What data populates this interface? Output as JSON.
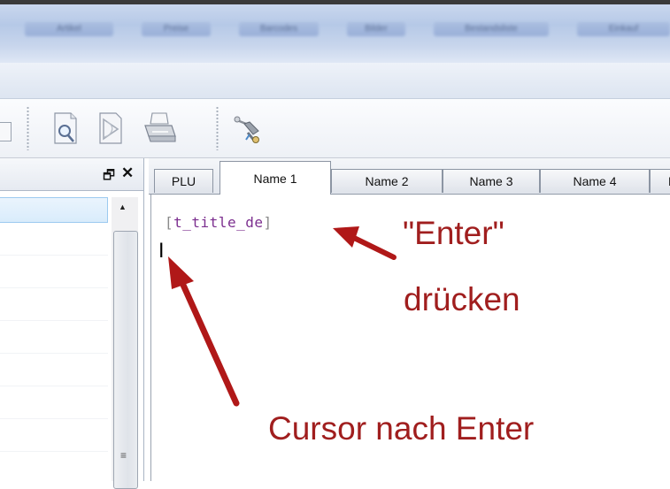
{
  "menu_tabs_blurred": [
    "Artikel",
    "Preise",
    "Barcodes",
    "Bilder",
    "Bestandsliste",
    "Einkauf"
  ],
  "left_panel": {
    "float_glyph": "🗗",
    "close_glyph": "✕"
  },
  "tabs": [
    {
      "label": "PLU",
      "active": false
    },
    {
      "label": "Name 1",
      "active": true
    },
    {
      "label": "Name 2",
      "active": false
    },
    {
      "label": "Name 3",
      "active": false
    },
    {
      "label": "Name 4",
      "active": false
    },
    {
      "label": "N",
      "active": false
    }
  ],
  "editor": {
    "open_bracket": "[",
    "tag": "t_title_de",
    "close_bracket": "]"
  },
  "annotations": {
    "enter_line1": "\"Enter\"",
    "enter_line2": "drücken",
    "cursor_label": "Cursor nach Enter"
  },
  "icons": [
    "print-preview-icon",
    "pdf-export-icon",
    "printer-icon",
    "tools-icon"
  ],
  "colors": {
    "annotation_red": "#a01e1e",
    "tag_purple": "#7c2f8f",
    "arrow_red": "#b01818"
  }
}
